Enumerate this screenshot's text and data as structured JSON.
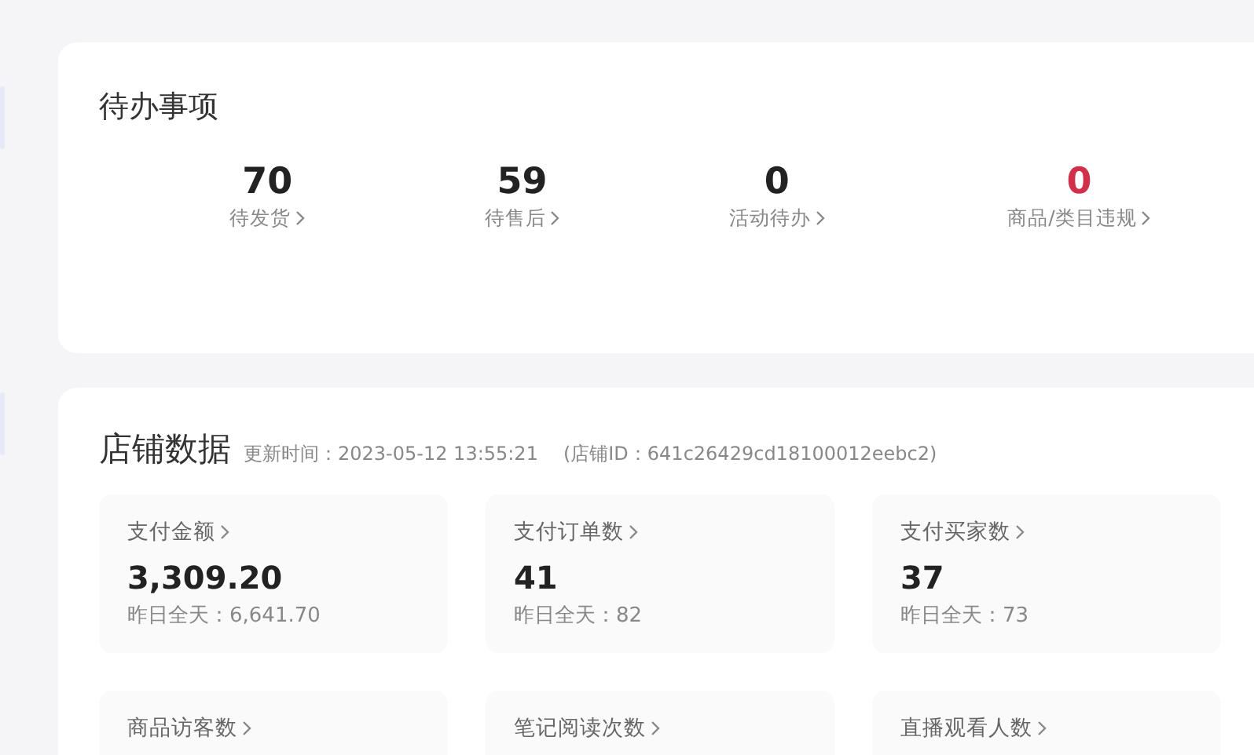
{
  "todo": {
    "title": "待办事项",
    "items": [
      {
        "count": "70",
        "label": "待发货",
        "alert": false
      },
      {
        "count": "59",
        "label": "待售后",
        "alert": false
      },
      {
        "count": "0",
        "label": "活动待办",
        "alert": false
      },
      {
        "count": "0",
        "label": "商品/类目违规",
        "alert": true
      }
    ]
  },
  "store": {
    "title": "店铺数据",
    "updated": "更新时间：2023-05-12 13:55:21",
    "store_id": "(店铺ID：641c26429cd18100012eebc2)",
    "metrics": [
      {
        "label": "支付金额",
        "value": "3,309.20",
        "yesterday": "昨日全天：6,641.70"
      },
      {
        "label": "支付订单数",
        "value": "41",
        "yesterday": "昨日全天：82"
      },
      {
        "label": "支付买家数",
        "value": "37",
        "yesterday": "昨日全天：73"
      },
      {
        "label": "商品访客数"
      },
      {
        "label": "笔记阅读次数"
      },
      {
        "label": "直播观看人数"
      }
    ]
  }
}
